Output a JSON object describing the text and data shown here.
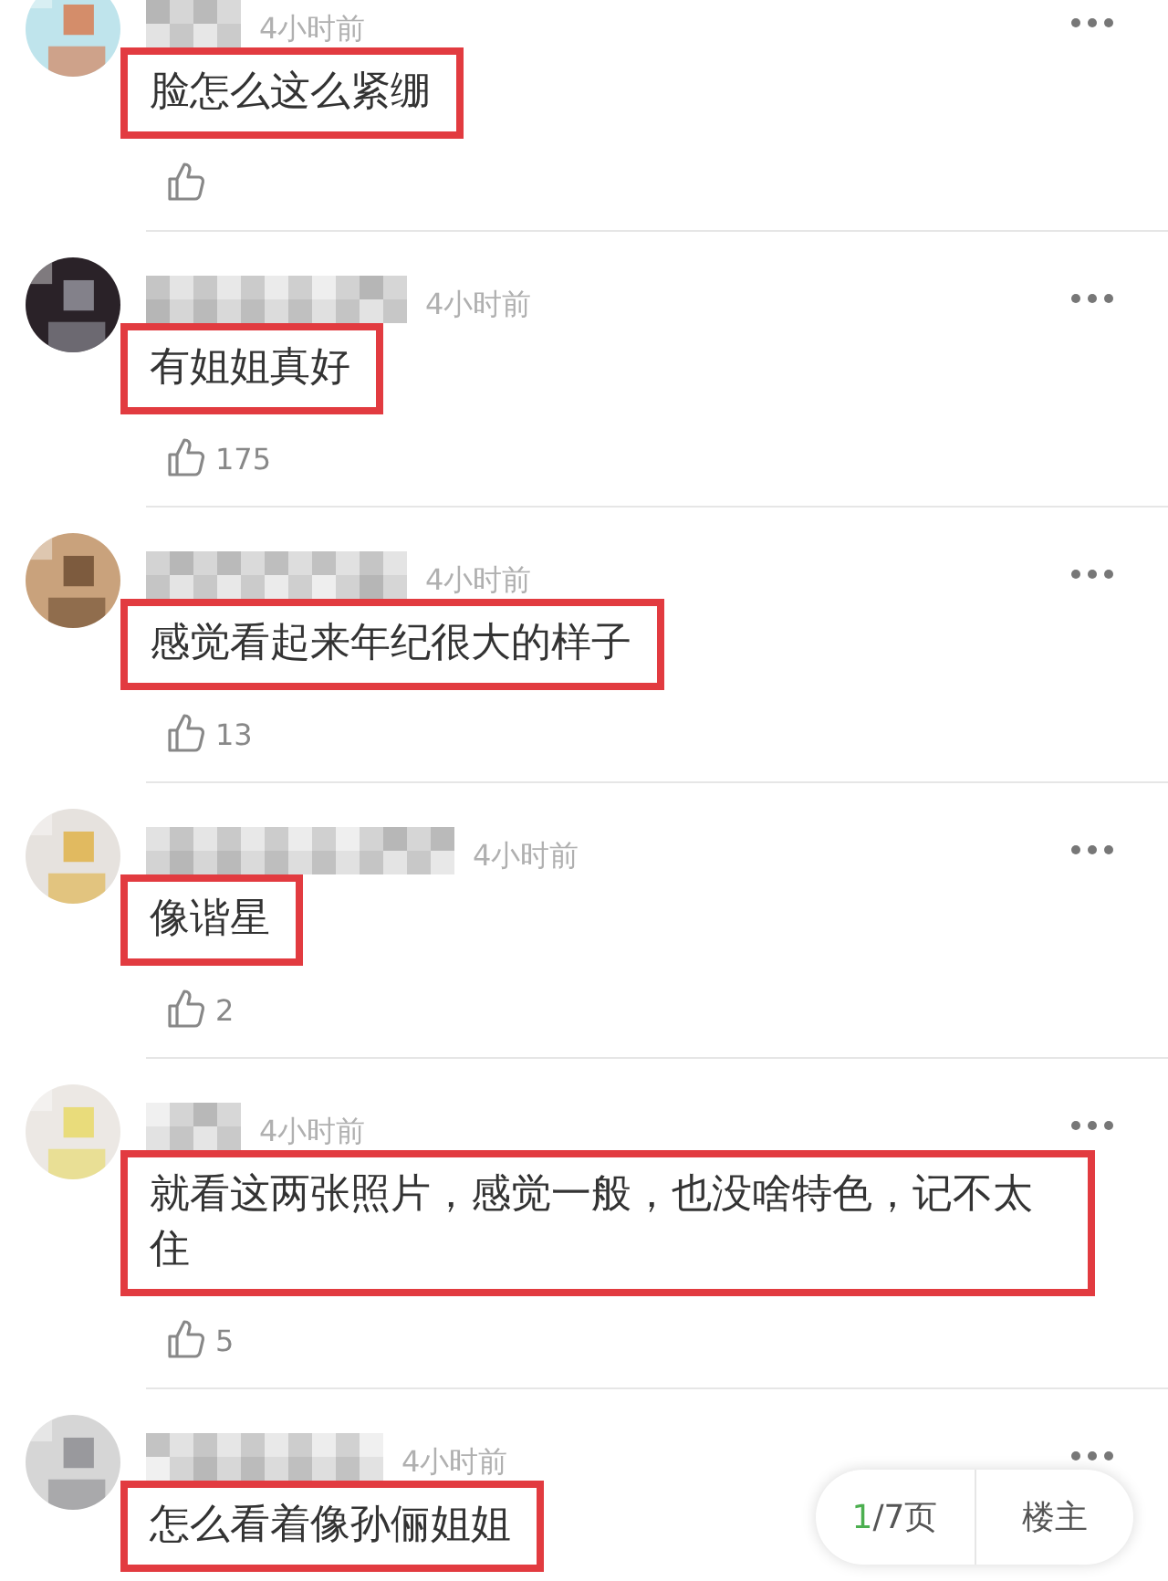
{
  "comments": [
    {
      "time": "4小时前",
      "text": "脸怎么这么紧绷"
    },
    {
      "time": "4小时前",
      "text": "有姐姐真好",
      "likes": "175"
    },
    {
      "time": "4小时前",
      "text": "感觉看起来年纪很大的样子",
      "likes": "13"
    },
    {
      "time": "4小时前",
      "text": "像谐星",
      "likes": "2"
    },
    {
      "time": "4小时前",
      "text": "就看这两张照片，感觉一般，也没啥特色，记不太住",
      "likes": "5"
    },
    {
      "time": "4小时前",
      "text": "怎么看着像孙俪姐姐"
    }
  ],
  "pager": {
    "current": "1",
    "total": "/7页",
    "author_button": "楼主"
  }
}
